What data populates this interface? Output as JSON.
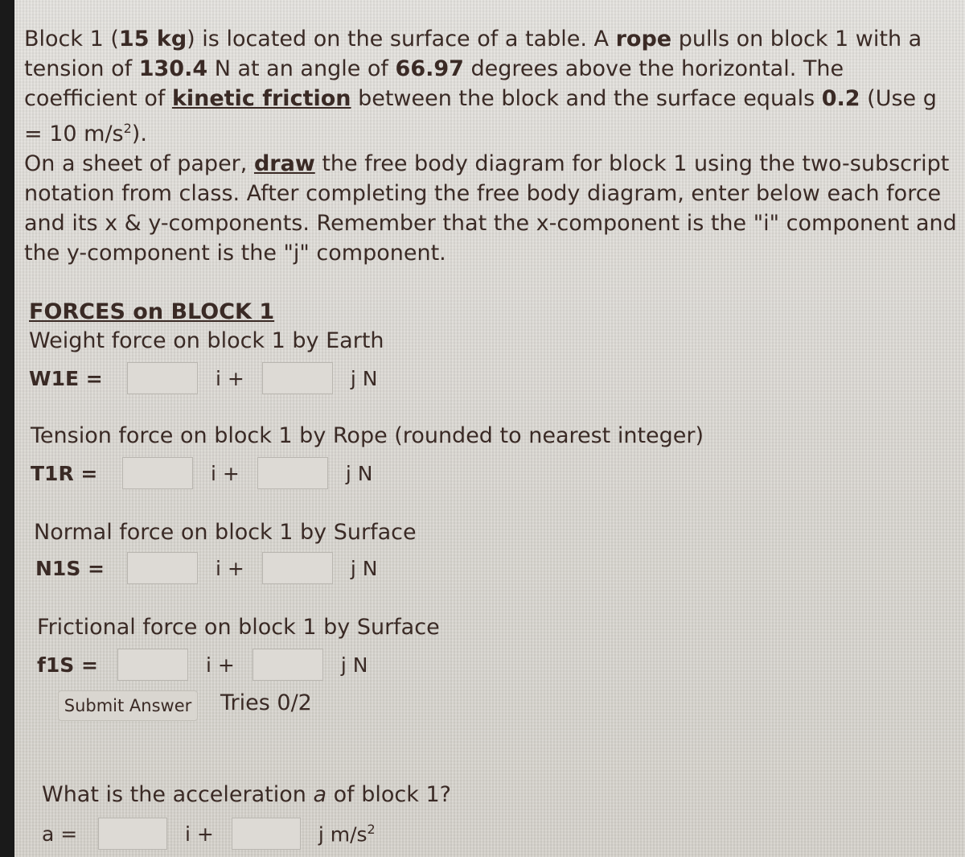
{
  "problem": {
    "p1_a": "Block 1 (",
    "p1_mass": "15 kg",
    "p1_b": ") is located on the surface of a table. A ",
    "p1_rope": "rope",
    "p1_c": " pulls on block 1 with a tension of ",
    "p1_tension": "130.4",
    "p1_d": " N at an angle of ",
    "p1_angle": "66.97",
    "p1_e": " degrees above the horizontal. The coefficient of ",
    "p1_kf": "kinetic friction",
    "p1_f": " between the block and the surface equals ",
    "p1_mu": "0.2",
    "p1_g": " (Use g = 10 m/s",
    "p1_sup": "2",
    "p1_h": ").",
    "p2_a": "On a sheet of paper, ",
    "p2_draw": "draw",
    "p2_b": " the free body diagram for block 1 using the two-subscript notation from class. After completing the free body diagram, enter below each force and its x & y-components. Remember that the x-component is the \"i\" component and the y-component is the \"j\" component."
  },
  "forces_heading": "FORCES on BLOCK 1",
  "forces": [
    {
      "desc": "Weight force on block 1 by Earth",
      "var": "W1E =",
      "i_value": "",
      "j_value": "",
      "i_label": "i +",
      "unit": "j N"
    },
    {
      "desc": "Tension force on block 1 by Rope (rounded to nearest integer)",
      "var": "T1R =",
      "i_value": "",
      "j_value": "",
      "i_label": "i +",
      "unit": "j N"
    },
    {
      "desc": "Normal force on block 1 by Surface",
      "var": "N1S =",
      "i_value": "",
      "j_value": "",
      "i_label": "i +",
      "unit": "j N"
    },
    {
      "desc": "Frictional force on block 1 by Surface",
      "var": "f1S =",
      "i_value": "",
      "j_value": "",
      "i_label": "i +",
      "unit": "j N"
    }
  ],
  "submit_label": "Submit Answer",
  "tries": "Tries 0/2",
  "acceleration": {
    "question_a": "What is the acceleration ",
    "question_var": "a",
    "question_b": " of block 1?",
    "var": "a =",
    "i_label": "i +",
    "unit": "j m/s",
    "unit_sup": "2",
    "i_value": "",
    "j_value": ""
  }
}
